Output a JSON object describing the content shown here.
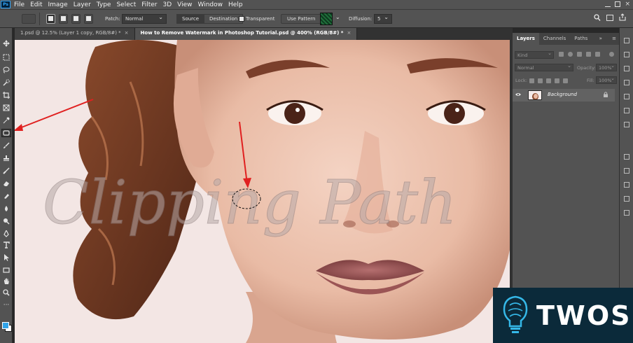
{
  "app": {
    "logo": "Ps"
  },
  "menu": [
    "File",
    "Edit",
    "Image",
    "Layer",
    "Type",
    "Select",
    "Filter",
    "3D",
    "View",
    "Window",
    "Help"
  ],
  "options_bar": {
    "patch_label": "Patch:",
    "patch_value": "Normal",
    "source_label": "Source",
    "destination_label": "Destination",
    "transparent_label": "Transparent",
    "use_pattern_label": "Use Pattern",
    "diffusion_label": "Diffusion:",
    "diffusion_value": "5"
  },
  "tabs": [
    {
      "label": "1.psd @ 12.5% (Layer 1 copy, RGB/8#) *",
      "active": false
    },
    {
      "label": "How to Remove Watermark in Photoshop Tutorial.psd @ 400% (RGB/8#) *",
      "active": true
    }
  ],
  "canvas": {
    "watermark_text": "Clipping Path"
  },
  "layers_panel": {
    "tabs": [
      "Layers",
      "Channels",
      "Paths"
    ],
    "active_tab": "Layers",
    "filter_placeholder": "Kind",
    "blend_mode": "Normal",
    "opacity_label": "Opacity:",
    "opacity_value": "100%",
    "lock_label": "Lock:",
    "fill_label": "Fill:",
    "fill_value": "100%",
    "layer_name": "Background"
  },
  "overlay_logo": {
    "text": "TWOS"
  },
  "colors": {
    "foreground": "#30a4ea",
    "background": "#ffffff",
    "annotation": "#e02020",
    "brand_bg": "#0b2a3a"
  },
  "icons": [
    "move-icon",
    "marquee-icon",
    "lasso-icon",
    "quick-select-icon",
    "crop-icon",
    "frame-icon",
    "eyedropper-icon",
    "patch-tool-icon",
    "brush-icon",
    "clone-stamp-icon",
    "history-brush-icon",
    "eraser-icon",
    "gradient-icon",
    "blur-icon",
    "dodge-icon",
    "pen-icon",
    "type-icon",
    "path-select-icon",
    "rectangle-icon",
    "hand-icon",
    "zoom-icon",
    "search-icon",
    "workspace-icon",
    "share-icon",
    "eye-icon",
    "lock-icon"
  ]
}
